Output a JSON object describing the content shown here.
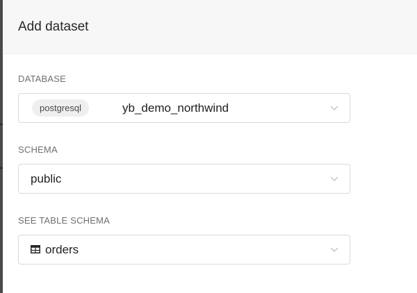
{
  "panel": {
    "title": "Add dataset"
  },
  "fields": {
    "database": {
      "label": "DATABASE",
      "tag": "postgresql",
      "value": "yb_demo_northwind",
      "icon": "chevron-down-icon"
    },
    "schema": {
      "label": "SCHEMA",
      "value": "public",
      "icon": "chevron-down-icon"
    },
    "table": {
      "label": "SEE TABLE SCHEMA",
      "value": "orders",
      "value_icon": "table-icon",
      "icon": "chevron-down-icon"
    }
  },
  "colors": {
    "header_bg": "#f7f7f7",
    "border": "#d9d9d9",
    "label": "#6f6f6f",
    "tag_bg": "#efefef"
  }
}
